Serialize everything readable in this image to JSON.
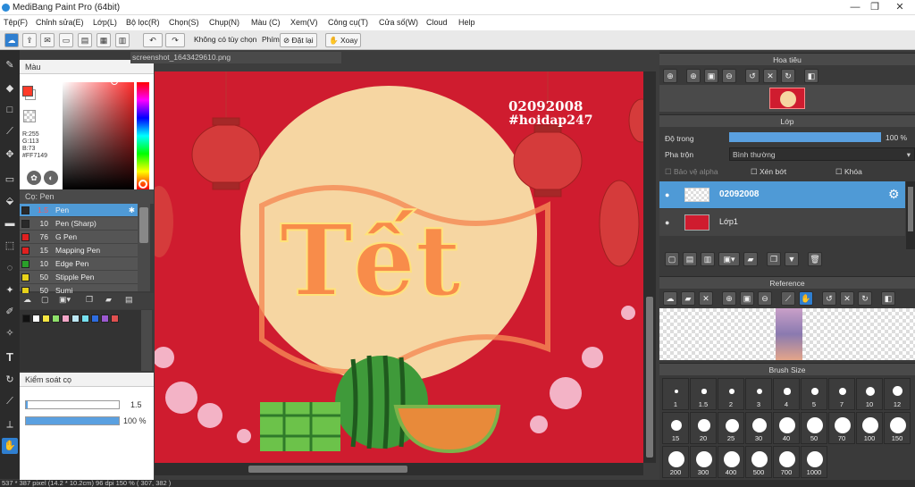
{
  "app": {
    "title": "MediBang Paint Pro (64bit)"
  },
  "menu": [
    "Tệp(F)",
    "Chỉnh sửa(E)",
    "Lớp(L)",
    "Bộ lọc(R)",
    "Chọn(S)",
    "Chụp(N)",
    "Màu (C)",
    "Xem(V)",
    "Công cụ(T)",
    "Cửa số(W)",
    "Cloud",
    "Help"
  ],
  "toolbar": {
    "no_options": "Không có tùy chọn",
    "key_label": "Phím",
    "reset_label": "Đặt lại",
    "rotate_label": "Xoay"
  },
  "document": {
    "tab": "screenshot_1643429610.png"
  },
  "color_panel": {
    "title": "Màu",
    "r": "R:255",
    "g": "G:113",
    "b": "B:73",
    "hex": "#FF7149",
    "fg_color": "#FF3B2A",
    "bg_color": "#FFFFFF"
  },
  "brush_panel": {
    "title": "Cọ: Pen",
    "items": [
      {
        "size": "1.5",
        "name": "Pen",
        "color": "#2a2a2a",
        "selected": true
      },
      {
        "size": "10",
        "name": "Pen (Sharp)",
        "color": "#2a2a2a"
      },
      {
        "size": "76",
        "name": "G Pen",
        "color": "#e02020"
      },
      {
        "size": "15",
        "name": "Mapping Pen",
        "color": "#e02020"
      },
      {
        "size": "10",
        "name": "Edge Pen",
        "color": "#2aa02a"
      },
      {
        "size": "50",
        "name": "Stipple Pen",
        "color": "#e8d21a"
      },
      {
        "size": "50",
        "name": "Sumi",
        "color": "#e8d21a"
      }
    ]
  },
  "palette": [
    "#111111",
    "#ffffff",
    "#f5e642",
    "#8ee06a",
    "#f4a6c8",
    "#bde8f5",
    "#76e0f0",
    "#2d6cdf",
    "#9b59d0",
    "#e05050"
  ],
  "control_panel": {
    "title": "Kiểm soát cọ",
    "size_value": "1.5",
    "opacity_value": "100 %",
    "size_fraction": 0.015,
    "opacity_fraction": 1.0
  },
  "artwork": {
    "line1": "02092008",
    "line2": "#hoidap247",
    "word": "Tết"
  },
  "navigator": {
    "title": "Hoa tiêu"
  },
  "layer_panel": {
    "title": "Lớp",
    "opacity_label": "Độ trong",
    "opacity_value": "100 %",
    "opacity_fraction": 1.0,
    "blend_label": "Pha trộn",
    "blend_value": "Bình thường",
    "protect_alpha": "Bảo vệ alpha",
    "clipping": "Xén bớt",
    "lock": "Khóa",
    "layers": [
      {
        "name": "02092008",
        "selected": true
      },
      {
        "name": "Lớp1",
        "selected": false
      }
    ]
  },
  "reference": {
    "title": "Reference"
  },
  "brush_size": {
    "title": "Brush Size",
    "sizes": [
      "1",
      "1.5",
      "2",
      "3",
      "4",
      "5",
      "7",
      "10",
      "12",
      "15",
      "20",
      "25",
      "30",
      "40",
      "50",
      "70",
      "100",
      "150",
      "200",
      "300",
      "400",
      "500",
      "700",
      "1000"
    ]
  },
  "status": {
    "text": "537 * 387 pixel   (14.2 * 10.2cm)   96 dpi   150 %   ( 307, 382 )"
  }
}
